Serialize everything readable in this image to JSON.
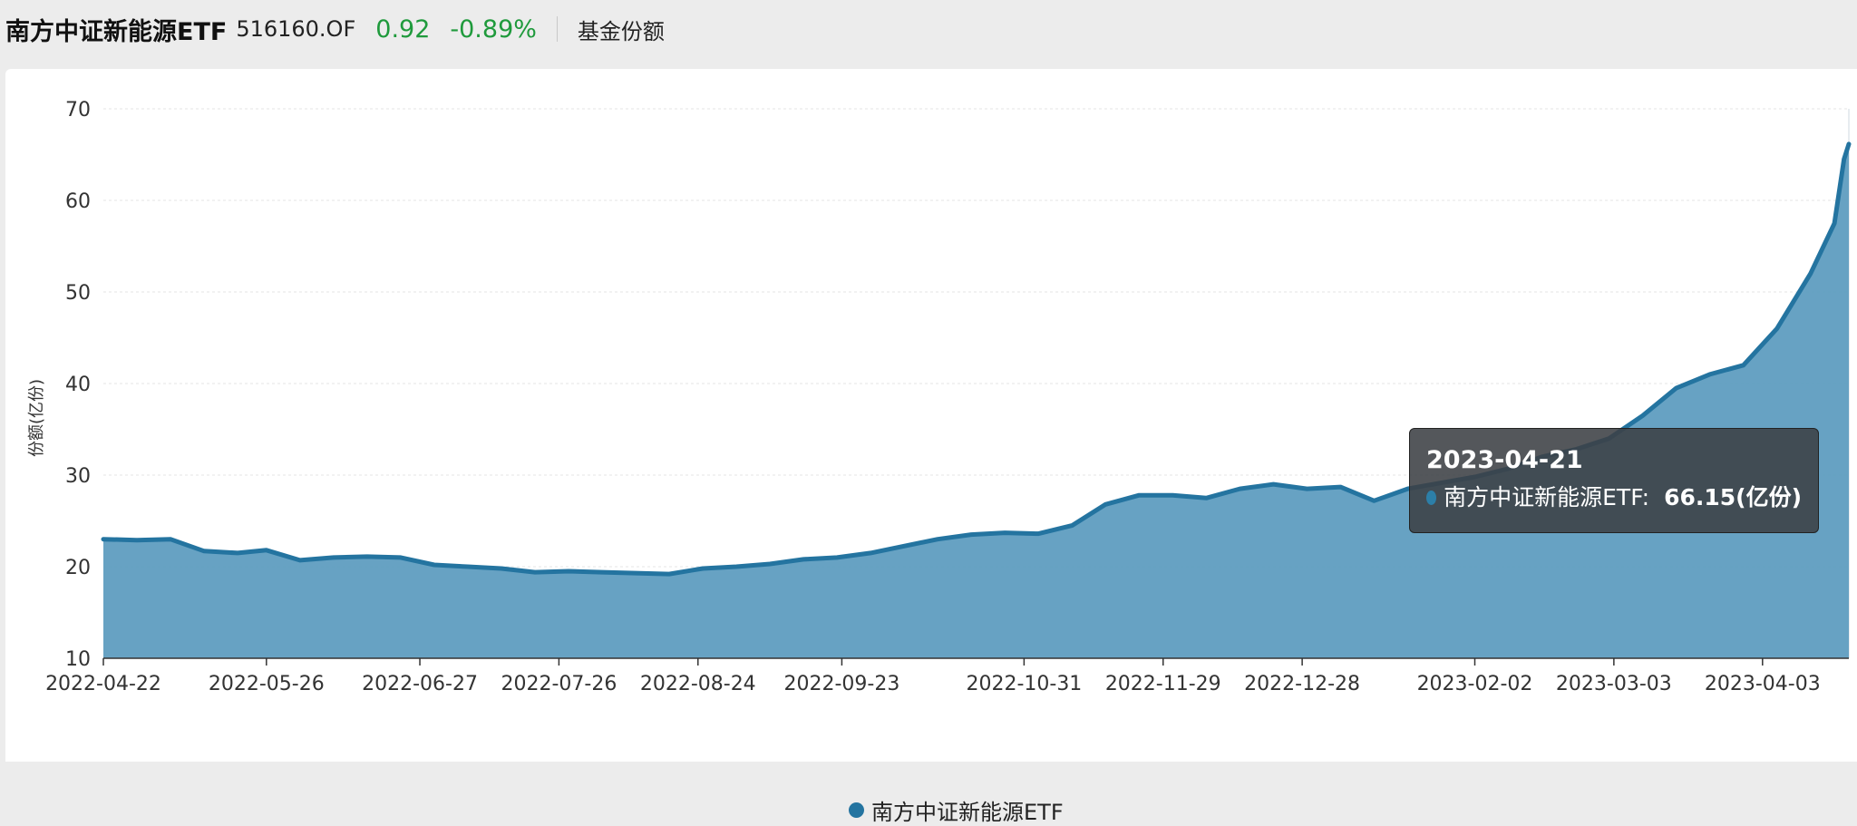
{
  "header": {
    "fund_name": "南方中证新能源ETF",
    "fund_code": "516160.OF",
    "nav": "0.92",
    "change_pct": "-0.89%",
    "metric": "基金份额"
  },
  "tooltip": {
    "date": "2023-04-21",
    "series_label": "南方中证新能源ETF:",
    "value_text": "66.15(亿份)"
  },
  "legend": {
    "label": "南方中证新能源ETF"
  },
  "colors": {
    "positive": "#1f9a3c",
    "line": "#2474a0",
    "area": "#5f9dc0"
  },
  "chart_data": {
    "type": "area",
    "ylabel": "份额(亿份)",
    "ylim": [
      10,
      70
    ],
    "yticks": [
      "10",
      "20",
      "30",
      "40",
      "50",
      "60",
      "70"
    ],
    "xlim": [
      "2022-04-22",
      "2023-04-21"
    ],
    "xticks": [
      "2022-04-22",
      "2022-05-26",
      "2022-06-27",
      "2022-07-26",
      "2022-08-24",
      "2022-09-23",
      "2022-10-31",
      "2022-11-29",
      "2022-12-28",
      "2023-02-02",
      "2023-03-03",
      "2023-04-03"
    ],
    "grid": true,
    "legend_position": "bottom-center",
    "series": [
      {
        "name": "南方中证新能源ETF",
        "x": [
          "2022-04-22",
          "2022-04-29",
          "2022-05-06",
          "2022-05-13",
          "2022-05-20",
          "2022-05-26",
          "2022-06-02",
          "2022-06-09",
          "2022-06-16",
          "2022-06-23",
          "2022-06-30",
          "2022-07-07",
          "2022-07-14",
          "2022-07-21",
          "2022-07-28",
          "2022-08-04",
          "2022-08-11",
          "2022-08-18",
          "2022-08-25",
          "2022-09-01",
          "2022-09-08",
          "2022-09-15",
          "2022-09-22",
          "2022-09-29",
          "2022-10-13",
          "2022-10-20",
          "2022-10-27",
          "2022-11-03",
          "2022-11-10",
          "2022-11-17",
          "2022-11-24",
          "2022-12-01",
          "2022-12-08",
          "2022-12-15",
          "2022-12-22",
          "2022-12-29",
          "2023-01-05",
          "2023-01-12",
          "2023-01-19",
          "2023-02-02",
          "2023-02-09",
          "2023-02-16",
          "2023-02-23",
          "2023-03-02",
          "2023-03-09",
          "2023-03-16",
          "2023-03-23",
          "2023-03-30",
          "2023-04-06",
          "2023-04-13",
          "2023-04-18",
          "2023-04-20",
          "2023-04-21"
        ],
        "values": [
          23.0,
          22.9,
          23.0,
          21.7,
          21.5,
          21.8,
          20.7,
          21.0,
          21.1,
          21.0,
          20.2,
          20.0,
          19.8,
          19.4,
          19.5,
          19.4,
          19.3,
          19.2,
          19.8,
          20.0,
          20.3,
          20.8,
          21.0,
          21.5,
          23.0,
          23.5,
          23.7,
          23.6,
          24.5,
          26.8,
          27.8,
          27.8,
          27.5,
          28.5,
          29.0,
          28.5,
          28.7,
          27.2,
          28.5,
          29.8,
          30.7,
          32.0,
          32.8,
          34.0,
          36.5,
          39.5,
          41.0,
          42.0,
          46.0,
          52.0,
          57.5,
          64.5,
          66.15
        ]
      }
    ]
  }
}
